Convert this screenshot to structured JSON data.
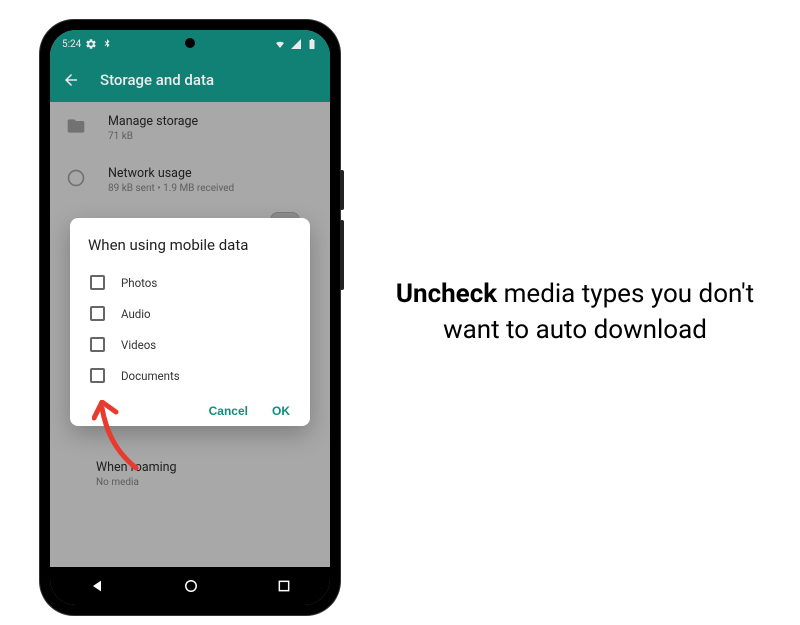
{
  "status_bar": {
    "time": "5:24",
    "icons_left": [
      "gear-icon",
      "bluetooth-icon"
    ],
    "icons_right": [
      "wifi-icon",
      "signal-icon",
      "battery-icon"
    ]
  },
  "app_bar": {
    "title": "Storage and data"
  },
  "settings": {
    "rows": [
      {
        "icon": "folder-icon",
        "title": "Manage storage",
        "sub": "71 kB"
      },
      {
        "icon": "data-usage-icon",
        "title": "Network usage",
        "sub": "89 kB sent • 1.9 MB received"
      }
    ],
    "partial_below": {
      "title": "When roaming",
      "sub": "No media"
    }
  },
  "dialog": {
    "title": "When using mobile data",
    "options": [
      {
        "label": "Photos",
        "checked": false
      },
      {
        "label": "Audio",
        "checked": false
      },
      {
        "label": "Videos",
        "checked": false
      },
      {
        "label": "Documents",
        "checked": false
      }
    ],
    "cancel": "Cancel",
    "ok": "OK"
  },
  "instruction": {
    "bold": "Uncheck",
    "rest": " media types you don't want to auto download"
  },
  "colors": {
    "accent": "#128C7E",
    "arrow": "#E83A2E"
  }
}
